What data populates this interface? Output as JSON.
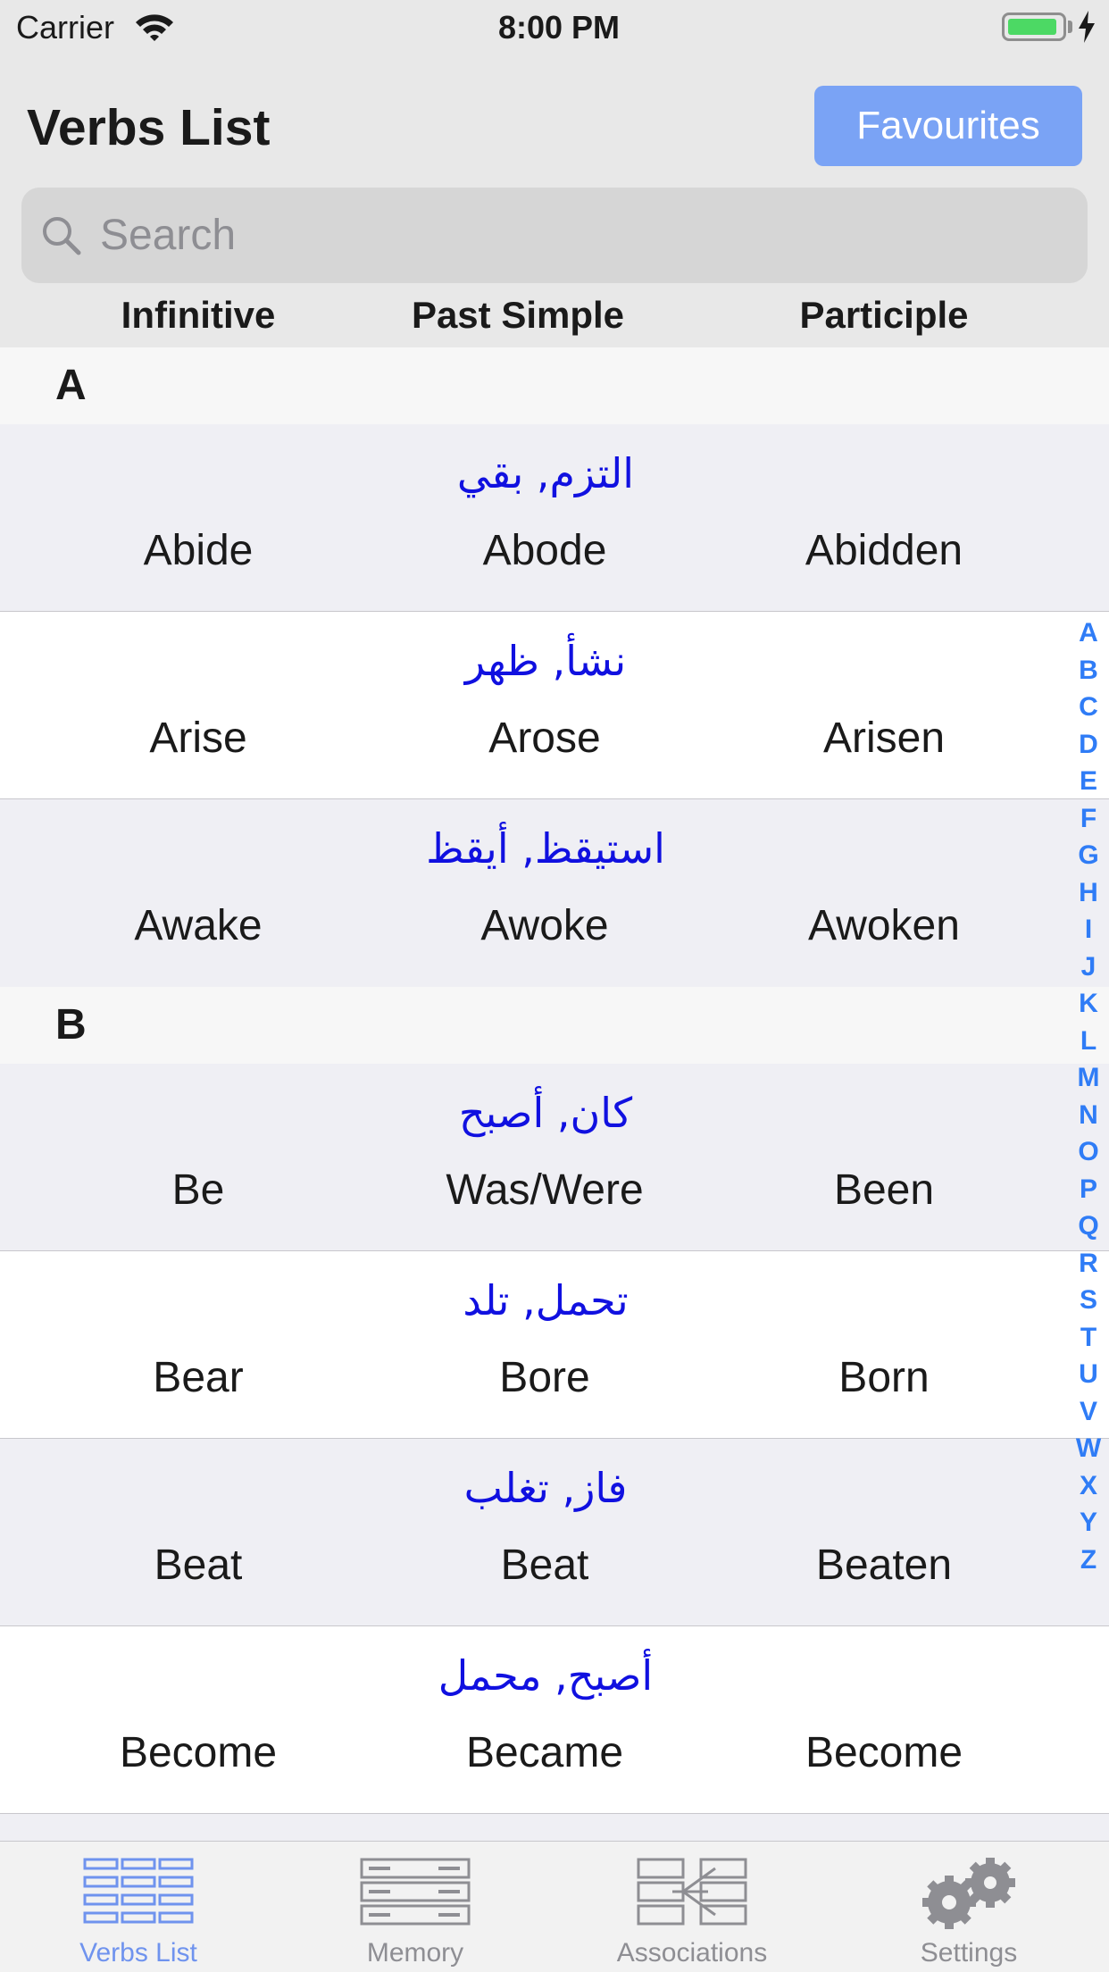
{
  "status": {
    "carrier": "Carrier",
    "time": "8:00 PM",
    "battery_level": 0.9
  },
  "header": {
    "title": "Verbs List",
    "favourites_label": "Favourites"
  },
  "search": {
    "placeholder": "Search",
    "value": ""
  },
  "columns": {
    "infinitive": "Infinitive",
    "past": "Past Simple",
    "participle": "Participle"
  },
  "sections": [
    {
      "letter": "A",
      "rows": [
        {
          "arabic": "التزم, بقي",
          "inf": "Abide",
          "past": "Abode",
          "part": "Abidden"
        },
        {
          "arabic": "نشأ, ظهر",
          "inf": "Arise",
          "past": "Arose",
          "part": "Arisen"
        },
        {
          "arabic": "استيقظ, أيقظ",
          "inf": "Awake",
          "past": "Awoke",
          "part": "Awoken"
        }
      ]
    },
    {
      "letter": "B",
      "rows": [
        {
          "arabic": "كان, أصبح",
          "inf": "Be",
          "past": "Was/Were",
          "part": "Been"
        },
        {
          "arabic": "تحمل, تلد",
          "inf": "Bear",
          "past": "Bore",
          "part": "Born"
        },
        {
          "arabic": "فاز, تغلب",
          "inf": "Beat",
          "past": "Beat",
          "part": "Beaten"
        },
        {
          "arabic": "أصبح, محمل",
          "inf": "Become",
          "past": "Became",
          "part": "Become"
        }
      ]
    }
  ],
  "alphabet": [
    "A",
    "B",
    "C",
    "D",
    "E",
    "F",
    "G",
    "H",
    "I",
    "J",
    "K",
    "L",
    "M",
    "N",
    "O",
    "P",
    "Q",
    "R",
    "S",
    "T",
    "U",
    "V",
    "W",
    "X",
    "Y",
    "Z"
  ],
  "tabs": [
    {
      "label": "Verbs List",
      "icon": "list-grid-icon",
      "active": true
    },
    {
      "label": "Memory",
      "icon": "memory-rack-icon",
      "active": false
    },
    {
      "label": "Associations",
      "icon": "associations-icon",
      "active": false
    },
    {
      "label": "Settings",
      "icon": "gears-icon",
      "active": false
    }
  ],
  "colors": {
    "accent": "#7aa3f5",
    "index_blue": "#2f7cf6",
    "arabic_blue": "#1010e0",
    "tab_active": "#6f93ee",
    "tab_inactive": "#8e8e93"
  }
}
